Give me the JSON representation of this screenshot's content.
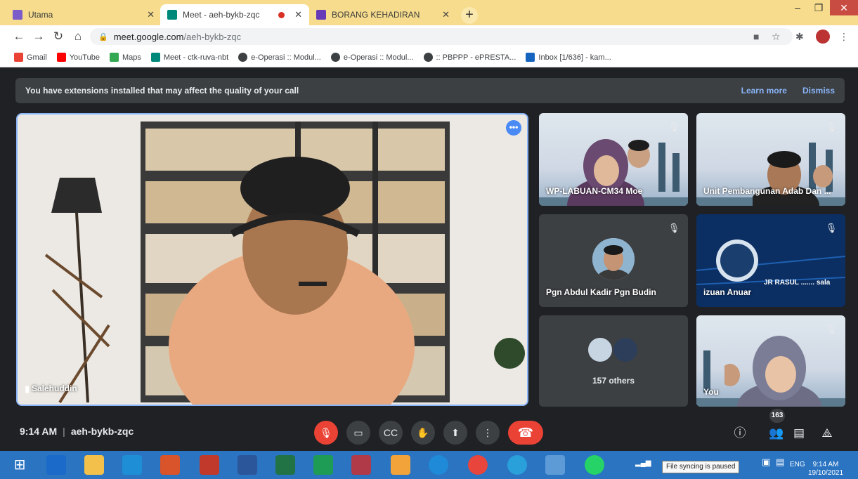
{
  "browser": {
    "tabs": [
      {
        "label": "Utama",
        "favicon_color": "#7b5cc8"
      },
      {
        "label": "Meet - aeh-bykb-zqc",
        "favicon_color": "#00897b",
        "recording": true
      },
      {
        "label": "BORANG KEHADIRAN",
        "favicon_color": "#673ab7"
      }
    ],
    "new_tab": "+",
    "window_controls": {
      "minimize": "–",
      "maximize": "❐",
      "close": "✕"
    },
    "address": {
      "host": "meet.google.com",
      "path": "/aeh-bykb-zqc"
    },
    "bookmarks": [
      {
        "label": "Gmail",
        "color": "#ea4335"
      },
      {
        "label": "YouTube",
        "color": "#ff0000"
      },
      {
        "label": "Maps",
        "color": "#34a853"
      },
      {
        "label": "Meet - ctk-ruva-nbt",
        "color": "#00897b"
      },
      {
        "label": "e-Operasi :: Modul...",
        "color": "#3c4043"
      },
      {
        "label": "e-Operasi :: Modul...",
        "color": "#3c4043"
      },
      {
        "label": ":: PBPPP - ePRESTA...",
        "color": "#3c4043"
      },
      {
        "label": "Inbox [1/636] - kam...",
        "color": "#1565c0"
      }
    ]
  },
  "meet": {
    "banner": {
      "text": "You have extensions installed that may affect the quality of your call",
      "learn_more": "Learn more",
      "dismiss": "Dismiss"
    },
    "main": {
      "name": "Salehuddin"
    },
    "tiles": [
      {
        "name": "WP-LABUAN-CM34 Moe"
      },
      {
        "name": "Unit Pembangunan Adab Dan ..."
      },
      {
        "name": "Pgn Abdul Kadir Pgn Budin"
      },
      {
        "name": "izuan Anuar",
        "overlay": "JR RASUL ....... sala"
      },
      {
        "name": "157 others"
      },
      {
        "name": "You"
      }
    ],
    "time": "9:14 AM",
    "meeting_code": "aeh-bykb-zqc",
    "participant_count": "163",
    "accent": "#8ab4f8",
    "danger": "#ea4335"
  },
  "taskbar": {
    "tooltip": "File syncing is paused",
    "lang": "ENG",
    "time": "9:14 AM",
    "date": "19/10/2021"
  }
}
